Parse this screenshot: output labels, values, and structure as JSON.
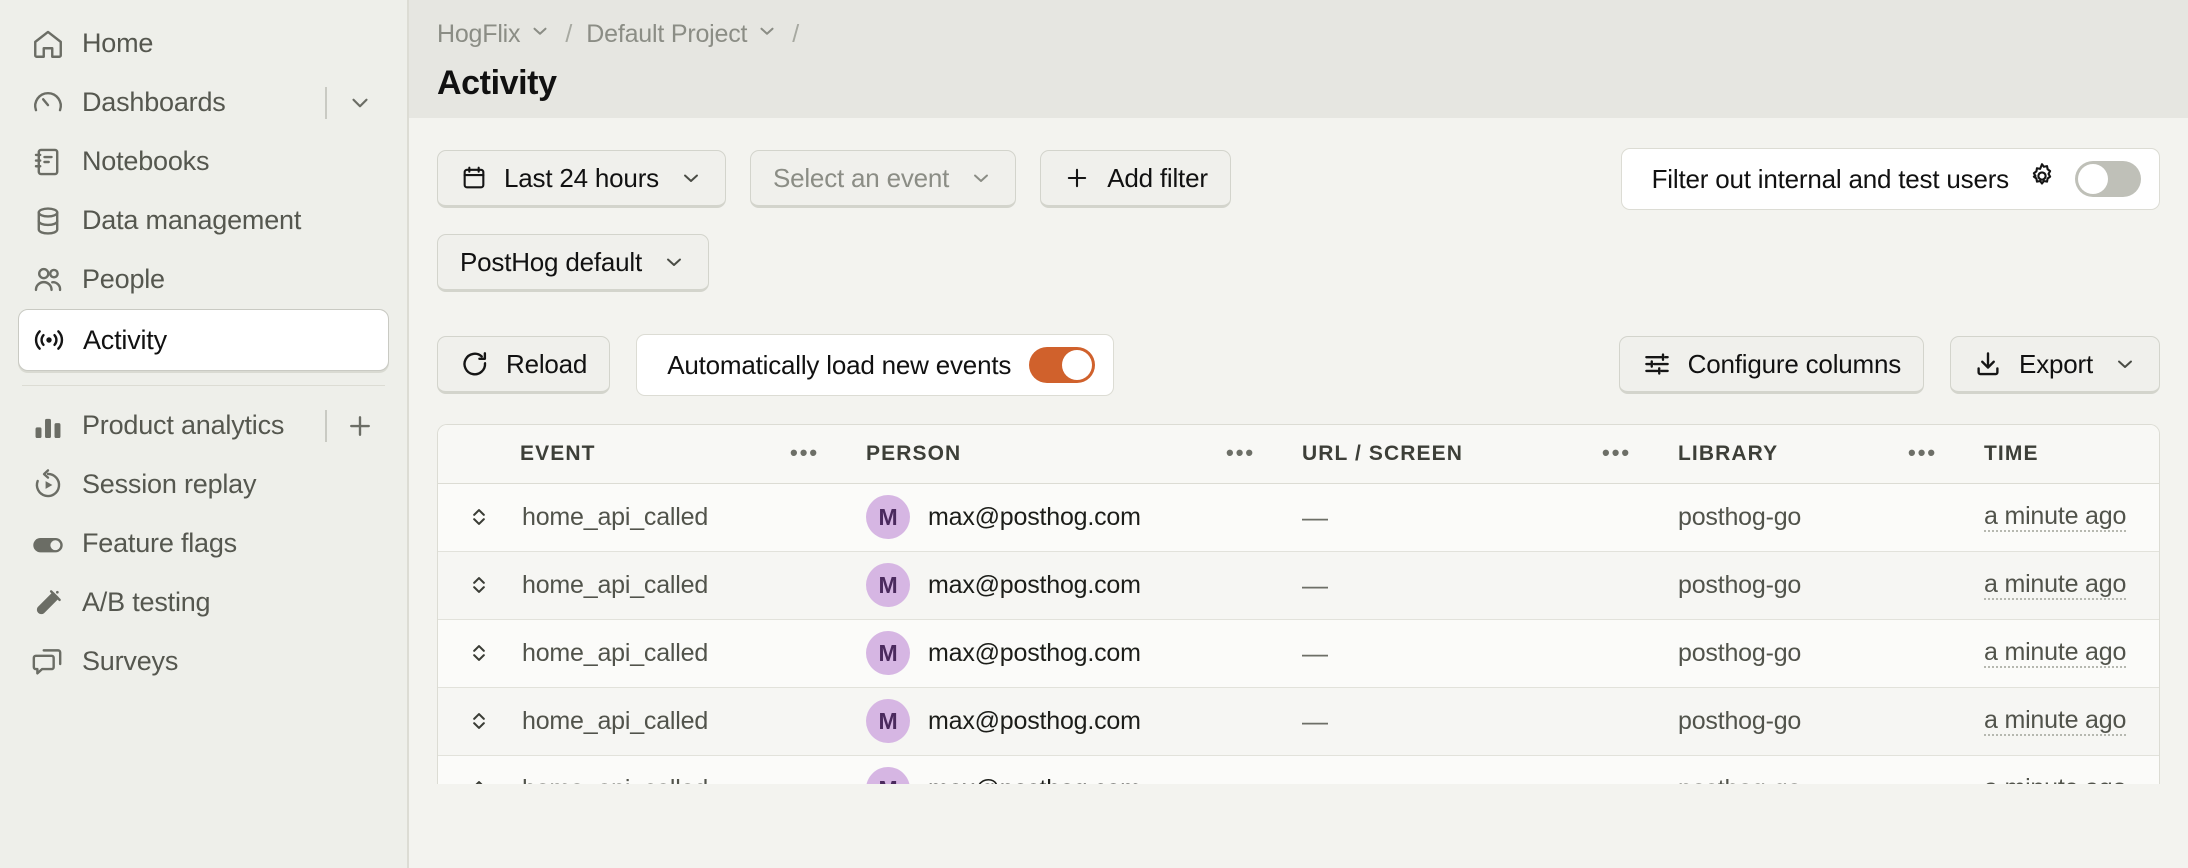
{
  "sidebar": {
    "primary": [
      {
        "label": "Home",
        "icon": "home-icon",
        "active": false
      },
      {
        "label": "Dashboards",
        "icon": "gauge-icon",
        "active": false,
        "trailing": "chevron-down"
      },
      {
        "label": "Notebooks",
        "icon": "notebook-icon",
        "active": false
      },
      {
        "label": "Data management",
        "icon": "database-icon",
        "active": false
      },
      {
        "label": "People",
        "icon": "people-icon",
        "active": false
      },
      {
        "label": "Activity",
        "icon": "live-events-icon",
        "active": true
      }
    ],
    "secondary": [
      {
        "label": "Product analytics",
        "icon": "bar-chart-icon",
        "trailing": "plus"
      },
      {
        "label": "Session replay",
        "icon": "replay-icon"
      },
      {
        "label": "Feature flags",
        "icon": "toggle-icon"
      },
      {
        "label": "A/B testing",
        "icon": "flask-icon"
      },
      {
        "label": "Surveys",
        "icon": "surveys-icon"
      }
    ]
  },
  "breadcrumb": {
    "org": "HogFlix",
    "project": "Default Project",
    "separator": "/",
    "trailing_separator": "/"
  },
  "page": {
    "title": "Activity"
  },
  "filters": {
    "date_range": "Last 24 hours",
    "event_placeholder": "Select an event",
    "add_filter": "Add filter",
    "internal_users_label": "Filter out internal and test users",
    "internal_users_on": false,
    "data_source": "PostHog default"
  },
  "toolbar": {
    "reload": "Reload",
    "autoload_label": "Automatically load new events",
    "autoload_on": true,
    "configure_columns": "Configure columns",
    "export": "Export"
  },
  "table": {
    "columns": [
      "EVENT",
      "PERSON",
      "URL / SCREEN",
      "LIBRARY",
      "TIME"
    ],
    "menu_glyph": "•••",
    "rows": [
      {
        "event": "home_api_called",
        "avatar": "M",
        "person": "max@posthog.com",
        "url": "—",
        "library": "posthog-go",
        "time": "a minute ago"
      },
      {
        "event": "home_api_called",
        "avatar": "M",
        "person": "max@posthog.com",
        "url": "—",
        "library": "posthog-go",
        "time": "a minute ago"
      },
      {
        "event": "home_api_called",
        "avatar": "M",
        "person": "max@posthog.com",
        "url": "—",
        "library": "posthog-go",
        "time": "a minute ago"
      },
      {
        "event": "home_api_called",
        "avatar": "M",
        "person": "max@posthog.com",
        "url": "—",
        "library": "posthog-go",
        "time": "a minute ago"
      },
      {
        "event": "home_api_called",
        "avatar": "M",
        "person": "max@posthog.com",
        "url": "—",
        "library": "posthog-go",
        "time": "a minute ago"
      }
    ]
  },
  "colors": {
    "accent_orange": "#d0612c",
    "sidebar_bg": "#eeefea",
    "topbar_bg": "#e6e6e1",
    "content_bg": "#f3f3ef",
    "avatar_bg": "#d6b6e3"
  }
}
